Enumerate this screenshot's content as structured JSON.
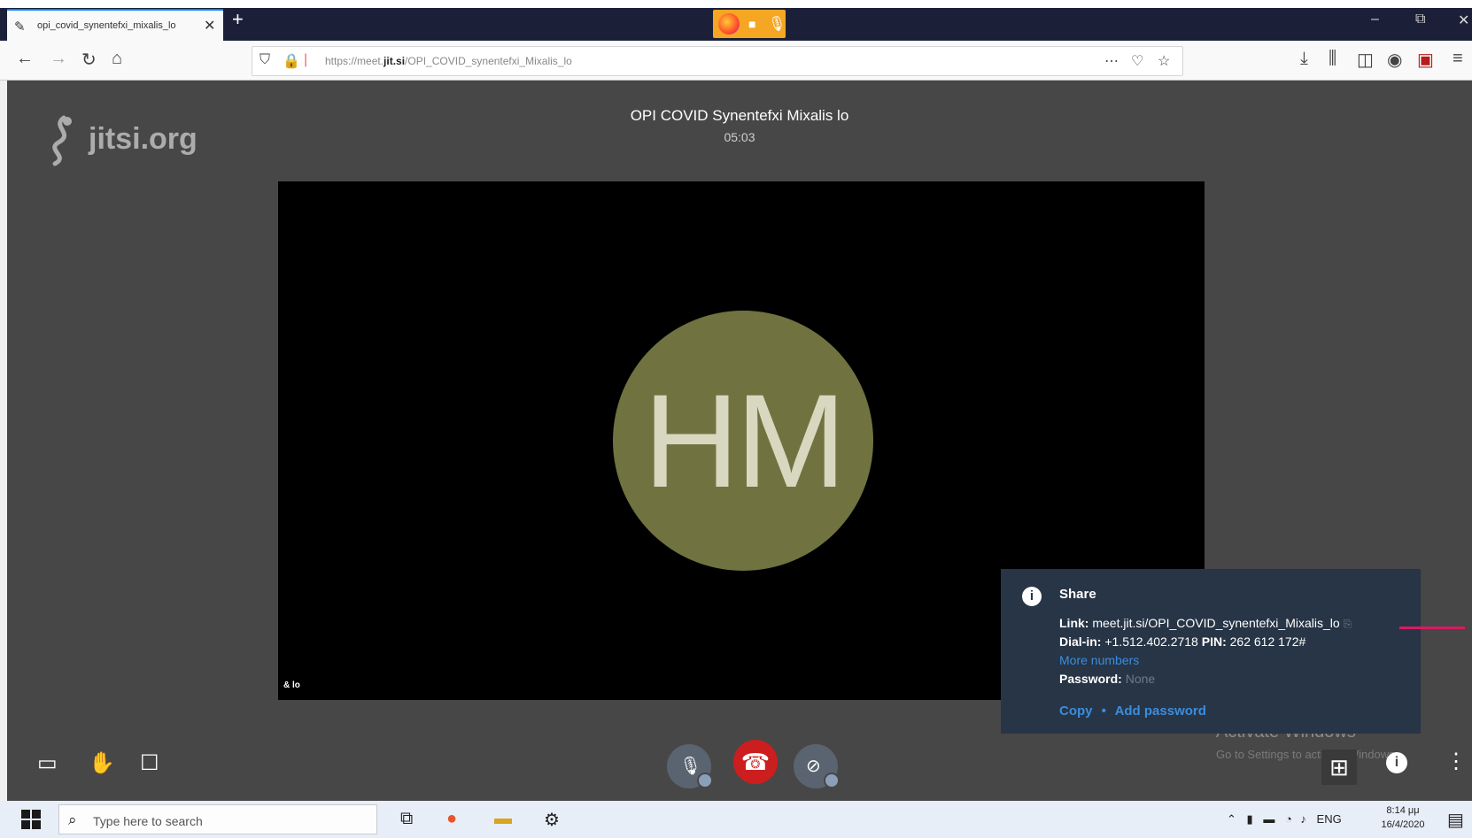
{
  "browser": {
    "tab_title": "opi_covid_synentefxi_mixalis_lo",
    "tab_close": "✕",
    "new_tab": "+",
    "url_prefix": "https://meet.",
    "url_domain": "jit.si",
    "url_path": "/OPI_COVID_synentefxi_Mixalis_lo",
    "window_controls": {
      "minimize": "‒",
      "restore": "⧉",
      "close": "✕"
    }
  },
  "conference": {
    "logo_text": "jitsi.org",
    "title": "OPI COVID Synentefxi Mixalis lo",
    "timer": "05:03",
    "avatar_initials": "HM",
    "participant_label": "& lo"
  },
  "share_popup": {
    "heading": "Share",
    "link_label": "Link:",
    "link_value": "meet.jit.si/OPI_COVID_synentefxi_Mixalis_lo",
    "dialin_label": "Dial-in:",
    "dialin_value": "+1.512.402.2718",
    "pin_label": "PIN:",
    "pin_value": "262 612 172#",
    "more_numbers": "More numbers",
    "password_label": "Password:",
    "password_value": "None",
    "copy": "Copy",
    "separator": "•",
    "add_password": "Add password"
  },
  "watermark": {
    "line1": "Activate Windows",
    "line2": "Go to Settings to activate Windows."
  },
  "taskbar": {
    "search_placeholder": "Type here to search",
    "language": "ENG",
    "time": "8:14 μμ",
    "date": "16/4/2020"
  },
  "icons": {
    "browser_nav": [
      "back-icon",
      "forward-icon",
      "reload-icon",
      "home-icon"
    ],
    "toolbar_left": [
      "screen-share-icon",
      "raise-hand-icon",
      "chat-icon"
    ],
    "toolbar_center": [
      "microphone-muted-icon",
      "hangup-icon",
      "camera-off-icon"
    ],
    "toolbar_right": [
      "tile-view-icon",
      "info-icon",
      "more-icon"
    ]
  },
  "colors": {
    "stage_bg": "#474747",
    "avatar_bg": "#707340",
    "hangup": "#cc1e1e",
    "share_bg": "#273546",
    "link": "#3a8dde",
    "pointer": "#d81b60"
  }
}
